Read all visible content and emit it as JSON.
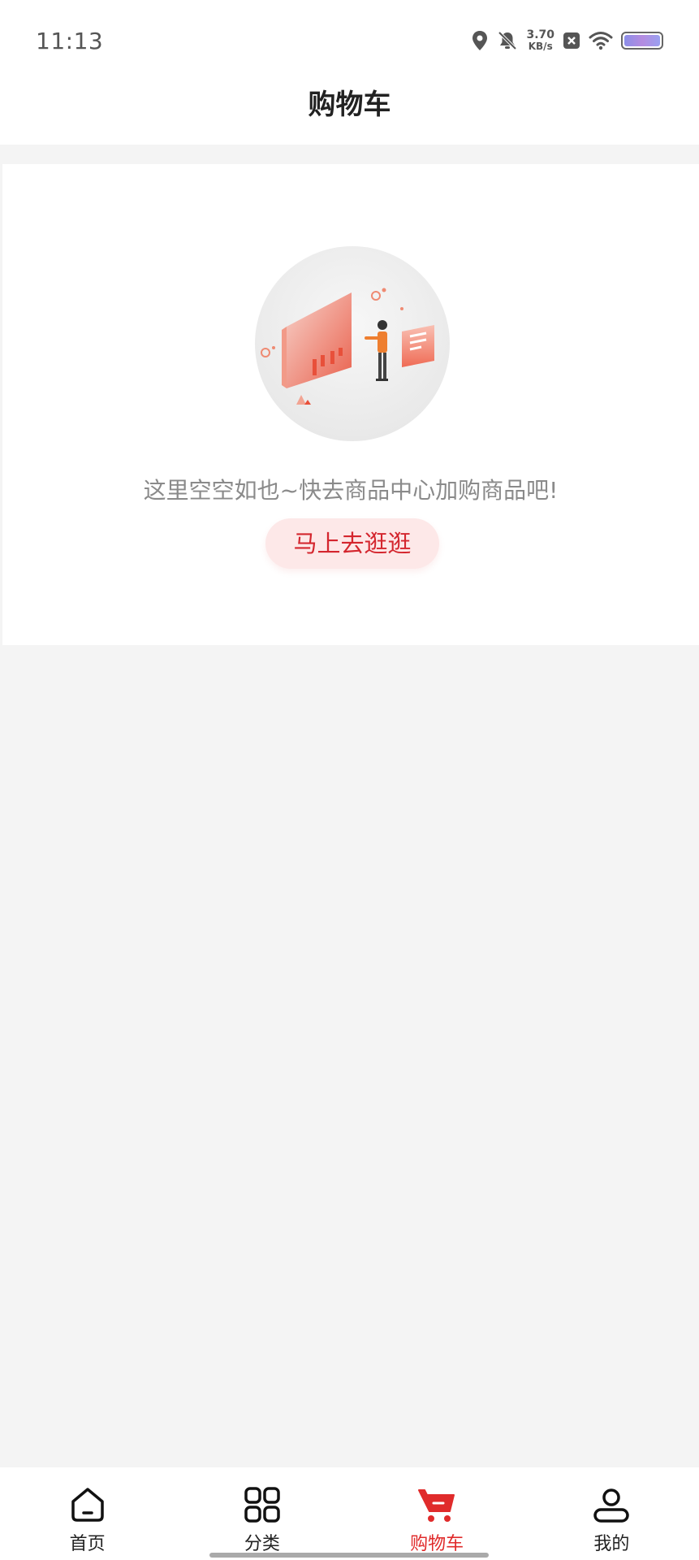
{
  "status_bar": {
    "time": "11:13",
    "net_speed_value": "3.70",
    "net_speed_unit": "KB/s",
    "icons": [
      "location-icon",
      "mute-icon",
      "close-box-icon",
      "wifi-icon",
      "battery-icon"
    ]
  },
  "header": {
    "title": "购物车"
  },
  "empty_state": {
    "message": "这里空空如也~快去商品中心加购商品吧!",
    "button_label": "马上去逛逛",
    "illustration": "empty-cart-illustration"
  },
  "tab_bar": {
    "tabs": [
      {
        "label": "首页",
        "icon": "home-icon",
        "active": false
      },
      {
        "label": "分类",
        "icon": "category-grid-icon",
        "active": false
      },
      {
        "label": "购物车",
        "icon": "cart-icon",
        "active": true
      },
      {
        "label": "我的",
        "icon": "profile-icon",
        "active": false
      }
    ]
  },
  "colors": {
    "accent": "#e02b2b",
    "button_bg": "#fde8e8",
    "page_bg": "#f4f4f4"
  }
}
